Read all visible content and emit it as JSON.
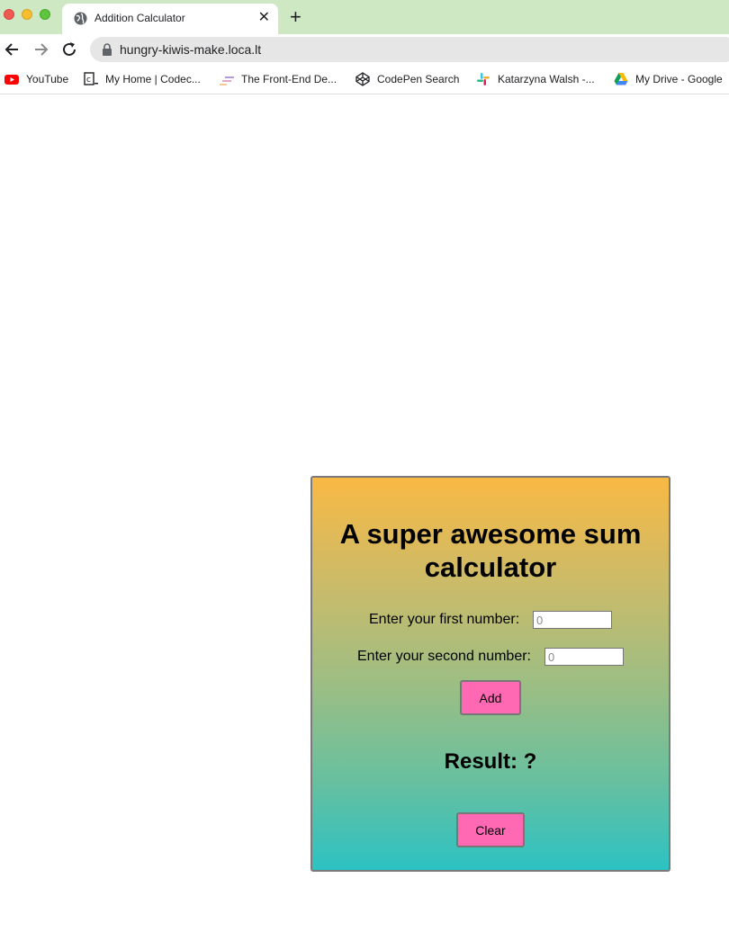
{
  "browser": {
    "tab": {
      "title": "Addition Calculator"
    },
    "address": {
      "url": "hungry-kiwis-make.loca.lt"
    },
    "bookmarks": [
      {
        "label": "YouTube",
        "icon": "youtube-icon"
      },
      {
        "label": "My Home | Codec...",
        "icon": "codecademy-icon"
      },
      {
        "label": "The Front-End De...",
        "icon": "frontend-icon"
      },
      {
        "label": "CodePen Search",
        "icon": "codepen-icon"
      },
      {
        "label": "Katarzyna Walsh -...",
        "icon": "slack-icon"
      },
      {
        "label": "My Drive - Google",
        "icon": "google-drive-icon"
      }
    ]
  },
  "calculator": {
    "title": "A super awesome sum calculator",
    "first_label": "Enter your first number:",
    "first_placeholder": "0",
    "second_label": "Enter your second number:",
    "second_placeholder": "0",
    "add_label": "Add",
    "result_text": "Result: ?",
    "clear_label": "Clear",
    "colors": {
      "gradient_top": "#f9b944",
      "gradient_bottom": "#2cc2c3",
      "button": "#ff69b4"
    }
  }
}
